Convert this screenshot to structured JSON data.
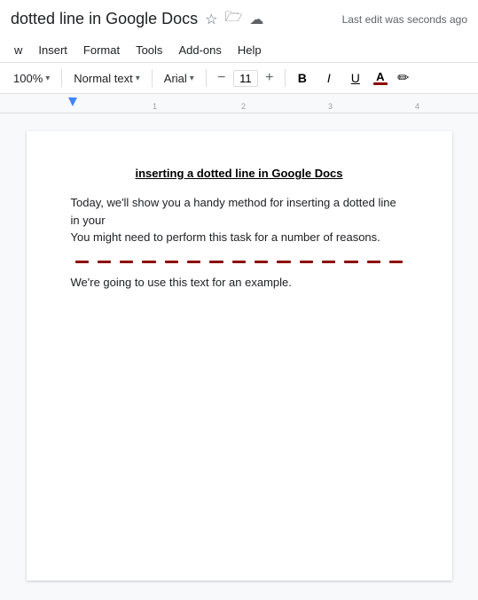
{
  "titleBar": {
    "title": "dotted line in Google Docs",
    "lastEdit": "Last edit was seconds ago"
  },
  "menuBar": {
    "items": [
      "w",
      "Insert",
      "Format",
      "Tools",
      "Add-ons",
      "Help"
    ]
  },
  "toolbar": {
    "zoom": "100%",
    "zoomChevron": "▾",
    "styleLabel": "Normal text",
    "styleChevron": "▾",
    "fontLabel": "Arial",
    "fontChevron": "▾",
    "minus": "−",
    "fontSize": "11",
    "plus": "+",
    "bold": "B",
    "italic": "I",
    "underline": "U",
    "fontColorLetter": "A",
    "fontColorBar": "#8b0000",
    "highlighter": "✏"
  },
  "document": {
    "heading": "inserting a dotted line in Google Docs",
    "bodyText": "Today, we'll show you a handy method for inserting a dotted line in your\nYou might need to perform this task for a number of reasons.",
    "exampleText": "We're going to use this text for an example.",
    "dottedSegments": 15
  }
}
